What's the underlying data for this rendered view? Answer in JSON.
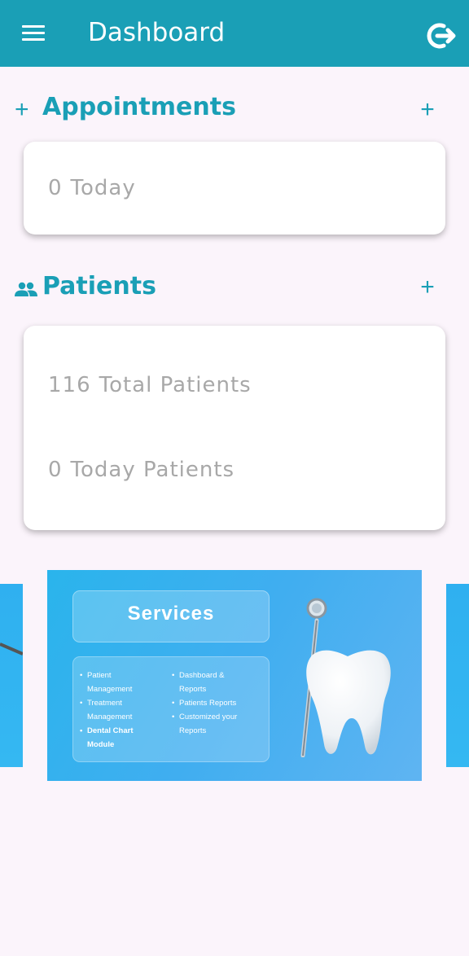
{
  "appbar": {
    "title": "Dashboard",
    "menu_icon": "menu-icon",
    "logout_icon": "logout-icon",
    "bg_color": "#1a9fb6"
  },
  "appointments": {
    "heading": "Appointments",
    "heading_icon": "plus-icon",
    "add_icon": "add-icon",
    "today_count": "0",
    "today_label": "Today"
  },
  "patients": {
    "heading": "Patients",
    "heading_icon": "people-icon",
    "add_icon": "add-icon",
    "total_count": "116",
    "total_label": "Total Patients",
    "today_count": "0",
    "today_label": "Today Patients"
  },
  "banner": {
    "title": "Services",
    "left_items": [
      {
        "text": "Patient",
        "bullet": true
      },
      {
        "text": "Management",
        "bullet": false
      },
      {
        "text": "Treatment",
        "bullet": true
      },
      {
        "text": "Management",
        "bullet": false
      },
      {
        "text": "Dental Chart",
        "bullet": true
      },
      {
        "text": "Module",
        "bullet": false
      }
    ],
    "right_items": [
      {
        "text": "Dashboard &",
        "bullet": true
      },
      {
        "text": "Reports",
        "bullet": false
      },
      {
        "text": "Patients Reports",
        "bullet": true
      },
      {
        "text": "Customized your",
        "bullet": true
      },
      {
        "text": "Reports",
        "bullet": false
      }
    ],
    "image_icons": [
      "tooth-icon",
      "dental-mirror-icon"
    ]
  }
}
